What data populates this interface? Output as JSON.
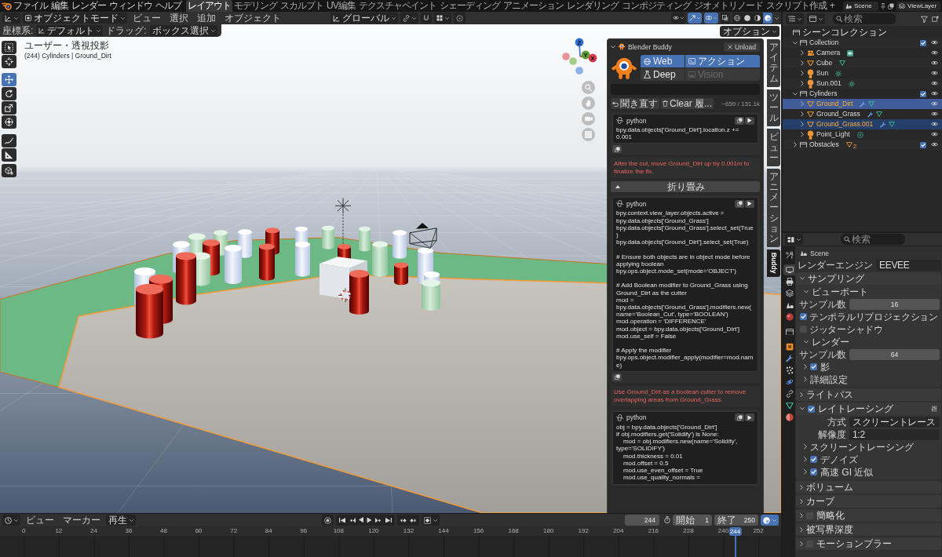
{
  "top_bar": {
    "menus": [
      "ファイル",
      "編集",
      "レンダー",
      "ウィンドウ",
      "ヘルプ"
    ],
    "workspaces": [
      {
        "label": "レイアウト",
        "selected": true
      },
      {
        "label": "モデリング",
        "selected": false
      },
      {
        "label": "スカルプト",
        "selected": false
      },
      {
        "label": "UV編集",
        "selected": false
      },
      {
        "label": "テクスチャペイント",
        "selected": false
      },
      {
        "label": "シェーディング",
        "selected": false
      },
      {
        "label": "アニメーション",
        "selected": false
      },
      {
        "label": "レンダリング",
        "selected": false
      },
      {
        "label": "コンポジティング",
        "selected": false
      },
      {
        "label": "ジオメトリノード",
        "selected": false
      },
      {
        "label": "スクリプト作成",
        "selected": false
      }
    ],
    "add_workspace": "+",
    "scene": "Scene",
    "view_layer": "ViewLayer"
  },
  "viewport_header": {
    "mode": "オブジェクトモード",
    "menus": [
      "ビュー",
      "選択",
      "追加",
      "オブジェクト"
    ],
    "orientation": "グローバル",
    "toggles": [
      {
        "kind": "visibility",
        "on": false
      },
      {
        "kind": "gizmo",
        "on": true
      },
      {
        "kind": "overlay",
        "on": true
      },
      {
        "kind": "xray",
        "on": false
      }
    ],
    "shading": [
      {
        "kind": "wireframe",
        "selected": false
      },
      {
        "kind": "solid",
        "selected": false
      },
      {
        "kind": "material",
        "selected": false
      },
      {
        "kind": "rendered",
        "selected": true
      }
    ]
  },
  "tool_settings": {
    "orientation_label": "座標系:",
    "orientation": "デフォルト",
    "drag_label": "ドラッグ:",
    "drag": "ボックス選択",
    "options": "オプション"
  },
  "viewport": {
    "view_name": "ユーザー・透視投影",
    "collection_info": "(244) Cylinders | Ground_Dirt",
    "tools": [
      {
        "kind": "select",
        "selected": false
      },
      {
        "kind": "cursor",
        "selected": false
      },
      {
        "kind": "move",
        "selected": true
      },
      {
        "kind": "rotate",
        "selected": false
      },
      {
        "kind": "scale",
        "selected": false
      },
      {
        "kind": "transform",
        "selected": false
      },
      {
        "kind": "annotate",
        "selected": false
      },
      {
        "kind": "measure",
        "selected": false
      },
      {
        "kind": "add_cube",
        "selected": false
      }
    ],
    "gizmo": [
      {
        "label": "Z",
        "color": "#2f6fd6"
      },
      {
        "label": "Y",
        "color": "#5f9e2f"
      },
      {
        "label": "X",
        "color": "#d93a4a"
      }
    ]
  },
  "sidebar_tabs": [
    {
      "label": "アイテム",
      "kind": "stacked",
      "selected": false
    },
    {
      "label": "ツール",
      "kind": "stacked",
      "selected": false
    },
    {
      "label": "ビュー",
      "kind": "stacked",
      "selected": false
    },
    {
      "label": "アニメーション",
      "kind": "stacked",
      "selected": false
    },
    {
      "label": "Buddy",
      "kind": "rotated",
      "selected": true
    }
  ],
  "buddy": {
    "title": "Blender Buddy",
    "unload": "Unload",
    "modes": [
      {
        "label": "Web",
        "kind": "web",
        "selected": true,
        "disabled": false
      },
      {
        "label": "アクション",
        "kind": "action",
        "selected": true,
        "disabled": false
      },
      {
        "label": "Deep",
        "kind": "deep",
        "selected": false,
        "disabled": false
      },
      {
        "label": "Vision",
        "kind": "vision",
        "selected": false,
        "disabled": true
      }
    ],
    "retry": "聞き直す",
    "clear": "Clear 履...",
    "tokens": "~659 / 131.1k",
    "messages": [
      {
        "kind": "code",
        "language": "python",
        "code": "bpy.data.objects['Ground_Dirt'].location.z += 0.001"
      },
      {
        "kind": "note",
        "text": "After the cut, move Ground_Dirt up by 0.001m to finalize the fix."
      },
      {
        "kind": "collapse",
        "label": "折り畳み"
      },
      {
        "kind": "code",
        "language": "python",
        "code": "bpy.context.view_layer.objects.active = bpy.data.objects['Ground_Grass']\nbpy.data.objects['Ground_Grass'].select_set(True)\nbpy.data.objects['Ground_Dirt'].select_set(True)\n\n# Ensure both objects are in object mode before applying boolean\nbpy.ops.object.mode_set(mode='OBJECT')\n\n# Add Boolean modifier to Ground_Grass using Ground_Dirt as the cutter\nmod = bpy.data.objects['Ground_Grass'].modifiers.new(name='Boolean_Cut', type='BOOLEAN')\nmod.operation = 'DIFFERENCE'\nmod.object = bpy.data.objects['Ground_Dirt']\nmod.use_self = False\n\n# Apply the modifier\nbpy.ops.object.modifier_apply(modifier=mod.name)"
      },
      {
        "kind": "note",
        "text": "Use Ground_Dirt as a boolean cutter to remove overlapping areas from Ground_Grass."
      },
      {
        "kind": "code",
        "language": "python",
        "code": "obj = bpy.data.objects['Ground_Dirt']\nif obj.modifiers.get('Solidify') is None:\n    mod = obj.modifiers.new(name='Solidify', type='SOLIDIFY')\n    mod.thickness = 0.01\n    mod.offset = 0.5\n    mod.use_even_offset = True\n    mod.use_quality_normals ="
      }
    ]
  },
  "outliner": {
    "search": {
      "placeholder": "検索"
    },
    "tree": [
      {
        "name": "シーンコレクション",
        "kind": "scene",
        "children": [
          {
            "name": "Collection",
            "kind": "collection",
            "expanded": true,
            "checked": true,
            "visible": true,
            "children": [
              {
                "name": "Camera",
                "kind": "camera",
                "expanded": false,
                "modifiers": false,
                "selected": false,
                "active": false,
                "visible": true
              },
              {
                "name": "Cube",
                "kind": "mesh",
                "expanded": false,
                "modifiers": false,
                "selected": false,
                "active": false,
                "visible": true
              },
              {
                "name": "Sun",
                "kind": "sun",
                "expanded": false,
                "modifiers": false,
                "selected": false,
                "active": false,
                "visible": true
              },
              {
                "name": "Sun.001",
                "kind": "sun",
                "expanded": false,
                "modifiers": false,
                "selected": false,
                "active": false,
                "visible": true
              }
            ]
          },
          {
            "name": "Cylinders",
            "kind": "collection",
            "expanded": true,
            "checked": true,
            "visible": true,
            "children": [
              {
                "name": "Ground_Dirt",
                "kind": "mesh",
                "expanded": false,
                "modifiers": true,
                "selected": true,
                "active": true,
                "visible": true
              },
              {
                "name": "Ground_Grass",
                "kind": "mesh",
                "expanded": false,
                "modifiers": true,
                "selected": false,
                "active": false,
                "visible": true
              },
              {
                "name": "Ground_Grass.001",
                "kind": "mesh",
                "expanded": false,
                "modifiers": true,
                "selected": true,
                "active": false,
                "visible": true
              },
              {
                "name": "Point_Light",
                "kind": "point_light",
                "expanded": false,
                "modifiers": false,
                "selected": false,
                "active": false,
                "visible": true
              }
            ]
          },
          {
            "name": "Obstacles",
            "kind": "collection",
            "expanded": false,
            "checked": true,
            "visible": true,
            "child_count": "2"
          }
        ]
      }
    ]
  },
  "properties": {
    "search": {
      "placeholder": "検索"
    },
    "tabs": [
      {
        "kind": "tool",
        "selected": false
      },
      {
        "kind": "render",
        "selected": true
      },
      {
        "kind": "output",
        "selected": false
      },
      {
        "kind": "view_layer",
        "selected": false
      },
      {
        "kind": "scene",
        "selected": false
      },
      {
        "kind": "world",
        "selected": false
      },
      {
        "kind": "collection",
        "selected": false
      },
      {
        "kind": "object",
        "selected": false
      },
      {
        "kind": "modifiers",
        "selected": false
      },
      {
        "kind": "particles",
        "selected": false
      },
      {
        "kind": "physics",
        "selected": false
      },
      {
        "kind": "constraints",
        "selected": false
      },
      {
        "kind": "data",
        "selected": false
      },
      {
        "kind": "material",
        "selected": false
      }
    ],
    "context": "Scene",
    "engine_label": "レンダーエンジン",
    "engine": "EEVEE",
    "panels": [
      {
        "kind": "plain",
        "title": "サンプリング",
        "expanded": true,
        "children": [
          {
            "kind": "subpanel",
            "title": "ビューポート",
            "expanded": true,
            "children": [
              {
                "kind": "number",
                "label": "サンプル数",
                "value": "16"
              },
              {
                "kind": "checkbox",
                "label": "テンポラルリプロジェクション",
                "checked": true
              },
              {
                "kind": "checkbox",
                "label": "ジッターシャドウ",
                "checked": false
              }
            ]
          },
          {
            "kind": "subpanel",
            "title": "レンダー",
            "expanded": true,
            "children": [
              {
                "kind": "number",
                "label": "サンプル数",
                "value": "64"
              }
            ]
          },
          {
            "kind": "subpanel",
            "title": "影",
            "expanded": false,
            "checked": true
          },
          {
            "kind": "subpanel",
            "title": "詳細設定",
            "expanded": false
          }
        ]
      },
      {
        "kind": "plain",
        "title": "ライトパス",
        "expanded": false
      },
      {
        "kind": "presets",
        "title": "レイトレーシング",
        "expanded": true,
        "checked": true,
        "children": [
          {
            "kind": "dropdown",
            "label": "方式",
            "value": "スクリーントレース"
          },
          {
            "kind": "dropdown",
            "label": "解像度",
            "value": "1:2"
          },
          {
            "kind": "subpanel",
            "title": "スクリーントレーシング",
            "expanded": false
          },
          {
            "kind": "subpanel",
            "title": "デノイズ",
            "expanded": false,
            "checked": true
          },
          {
            "kind": "subpanel",
            "title": "高速 GI 近似",
            "expanded": false,
            "checked": true
          }
        ]
      },
      {
        "kind": "plain",
        "title": "ボリューム",
        "expanded": false
      },
      {
        "kind": "plain",
        "title": "カーブ",
        "expanded": false
      },
      {
        "kind": "plain",
        "title": "簡略化",
        "expanded": false,
        "checked": false
      },
      {
        "kind": "plain",
        "title": "被写界深度",
        "expanded": false
      },
      {
        "kind": "plain",
        "title": "モーションブラー",
        "expanded": false,
        "checked": false
      }
    ]
  },
  "timeline": {
    "menus": [
      {
        "label": "ビュー",
        "kind": "menu"
      },
      {
        "label": "マーカー",
        "kind": "menu"
      },
      {
        "label": "再生",
        "kind": "dropdown"
      }
    ],
    "current_frame": "244",
    "start_label": "開始",
    "start": "1",
    "end_label": "終了",
    "end": "250",
    "ticks": [
      "0",
      "12",
      "24",
      "36",
      "48",
      "60",
      "72",
      "84",
      "96",
      "108",
      "120",
      "132",
      "144",
      "156",
      "168",
      "180",
      "192",
      "204",
      "216",
      "228",
      "240",
      "252"
    ],
    "playhead": {
      "label": "244",
      "level": 0.9683
    }
  }
}
